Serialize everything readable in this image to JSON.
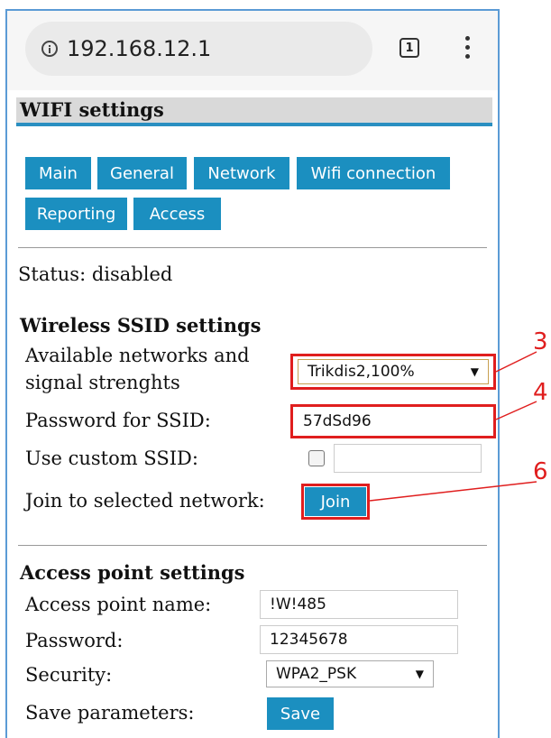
{
  "browser": {
    "url": "192.168.12.1",
    "tab_count": "1",
    "icons": [
      "info-icon",
      "tab-switcher-icon",
      "overflow-menu-icon"
    ]
  },
  "page": {
    "title": "WIFI settings",
    "tabs": [
      {
        "label": "Main"
      },
      {
        "label": "General"
      },
      {
        "label": "Network"
      },
      {
        "label": "Wifi connection"
      },
      {
        "label": "Reporting"
      },
      {
        "label": "Access"
      }
    ],
    "status": "Status: disabled"
  },
  "ssid_settings": {
    "heading": "Wireless SSID settings",
    "networks_label_line1": "Available networks and",
    "networks_label_line2": "signal strenghts",
    "networks_selected": "Trikdis2,100%",
    "password_label": "Password for SSID:",
    "password_value": "57dSd96",
    "custom_ssid_label": "Use custom SSID:",
    "custom_ssid_value": "",
    "join_label": "Join to selected network:",
    "join_button": "Join"
  },
  "ap_settings": {
    "heading": "Access point settings",
    "name_label": "Access point name:",
    "name_value": "!W!485",
    "password_label": "Password:",
    "password_value": "12345678",
    "security_label": "Security:",
    "security_selected": "WPA2_PSK",
    "save_label": "Save parameters:",
    "save_button": "Save"
  },
  "callouts": {
    "c3": "3",
    "c4": "4",
    "c6": "6",
    "color": "#e01e1e"
  },
  "colors": {
    "accent": "#1b8fc0",
    "header_bg": "#d9d9d9",
    "frame": "#5b9bd5"
  }
}
